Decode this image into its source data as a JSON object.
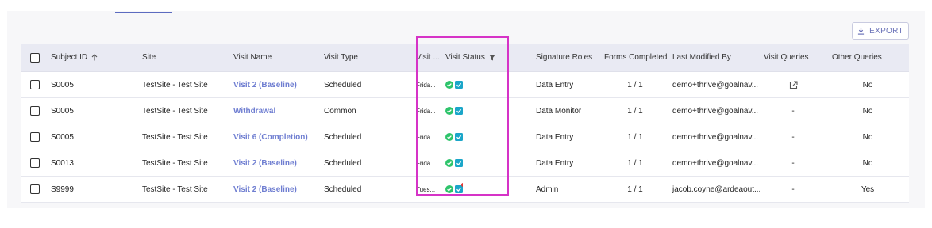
{
  "toolbar": {
    "export_label": "EXPORT"
  },
  "columns": {
    "subject_id": "Subject ID",
    "site": "Site",
    "visit_name": "Visit Name",
    "visit_type": "Visit Type",
    "visit_date": "Visit ...",
    "visit_status": "Visit Status",
    "signature_roles": "Signature Roles",
    "forms_completed": "Forms Completed",
    "last_modified_by": "Last Modified By",
    "visit_queries": "Visit Queries",
    "other_queries": "Other Queries"
  },
  "rows": [
    {
      "subject_id": "S0005",
      "site": "TestSite - Test Site",
      "visit_name": "Visit 2 (Baseline)",
      "visit_type": "Scheduled",
      "visit_date": "Frida...",
      "signature_roles": "Data Entry",
      "forms_completed": "1 / 1",
      "last_modified_by": "demo+thrive@goalnav...",
      "visit_queries": "",
      "other_queries": "No"
    },
    {
      "subject_id": "S0005",
      "site": "TestSite - Test Site",
      "visit_name": "Withdrawal",
      "visit_type": "Common",
      "visit_date": "Frida...",
      "signature_roles": "Data Monitor",
      "forms_completed": "1 / 1",
      "last_modified_by": "demo+thrive@goalnav...",
      "visit_queries": "-",
      "other_queries": "No"
    },
    {
      "subject_id": "S0005",
      "site": "TestSite - Test Site",
      "visit_name": "Visit 6 (Completion)",
      "visit_type": "Scheduled",
      "visit_date": "Frida...",
      "signature_roles": "Data Entry",
      "forms_completed": "1 / 1",
      "last_modified_by": "demo+thrive@goalnav...",
      "visit_queries": "-",
      "other_queries": "No"
    },
    {
      "subject_id": "S0013",
      "site": "TestSite - Test Site",
      "visit_name": "Visit 2 (Baseline)",
      "visit_type": "Scheduled",
      "visit_date": "Frida...",
      "signature_roles": "Data Entry",
      "forms_completed": "1 / 1",
      "last_modified_by": "demo+thrive@goalnav...",
      "visit_queries": "-",
      "other_queries": "No"
    },
    {
      "subject_id": "S9999",
      "site": "TestSite - Test Site",
      "visit_name": "Visit 2 (Baseline)",
      "visit_type": "Scheduled",
      "visit_date": "Tues...",
      "signature_roles": "Admin",
      "forms_completed": "1 / 1",
      "last_modified_by": "jacob.coyne@ardeaout...",
      "visit_queries": "-",
      "other_queries": "Yes"
    }
  ],
  "colors": {
    "accent": "#6f7ed1",
    "status_green": "#2ec46b",
    "status_teal": "#1ba6c9",
    "alert_red": "#e53935",
    "highlight_magenta": "#d633c7"
  }
}
